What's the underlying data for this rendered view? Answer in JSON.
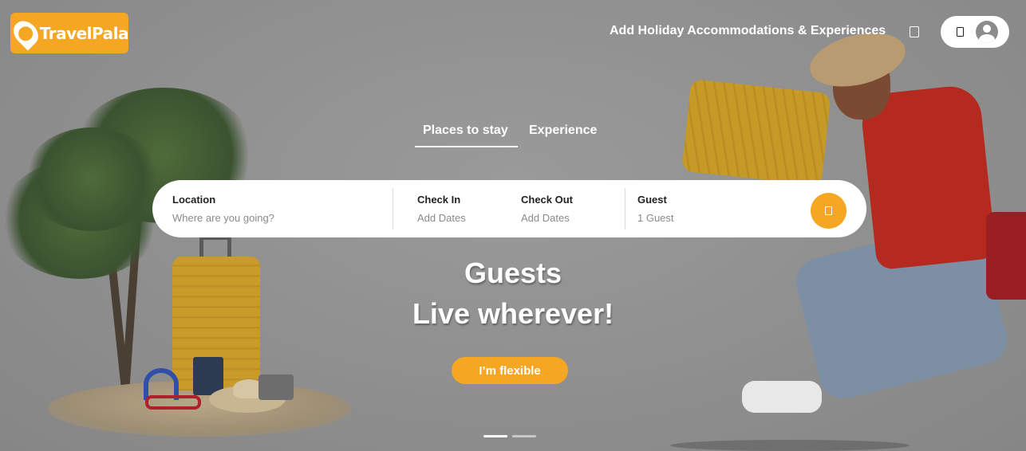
{
  "brand": {
    "name": "TravelPala",
    "accent_color": "#f5a623"
  },
  "header": {
    "nav_link": "Add Holiday Accommodations & Experiences",
    "globe_icon": "globe-icon",
    "menu_icon": "menu-icon",
    "avatar_icon": "user-avatar-icon"
  },
  "tabs": [
    {
      "label": "Places to stay",
      "active": true
    },
    {
      "label": "Experience",
      "active": false
    }
  ],
  "search": {
    "location": {
      "label": "Location",
      "placeholder": "Where are you going?"
    },
    "check_in": {
      "label": "Check In",
      "placeholder": "Add Dates"
    },
    "check_out": {
      "label": "Check Out",
      "placeholder": "Add Dates"
    },
    "guest": {
      "label": "Guest",
      "value": "1 Guest"
    },
    "button_icon": "search-icon"
  },
  "hero": {
    "line1": "Guests",
    "line2": "Live wherever!",
    "cta": "I’m flexible"
  },
  "carousel": {
    "slides": 2,
    "active_index": 0
  }
}
